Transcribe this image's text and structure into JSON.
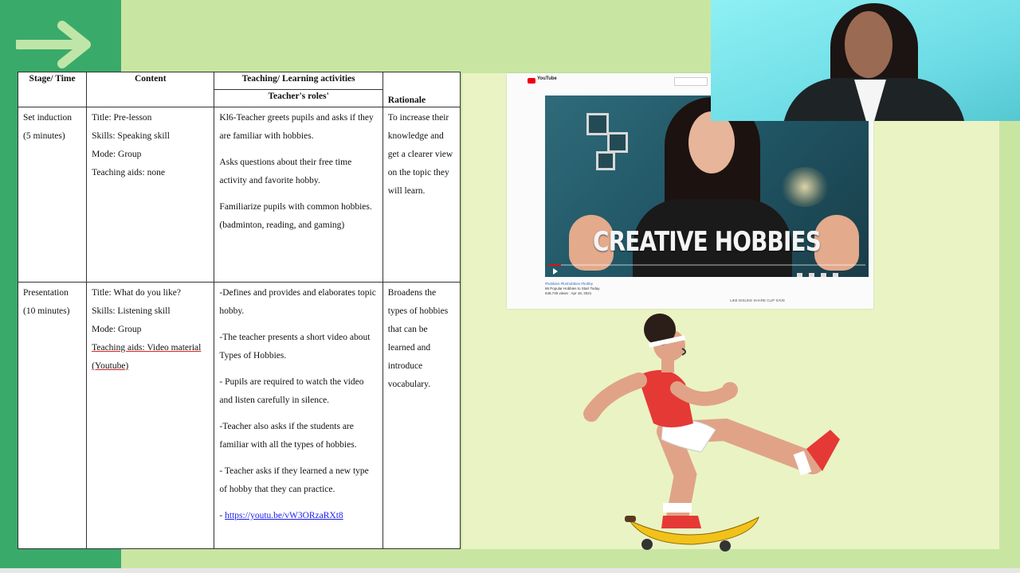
{
  "table": {
    "headers": {
      "stage": "Stage/ Time",
      "content": "Content",
      "activities": "Teaching/ Learning activities",
      "teacher_roles": "Teacher's roles'",
      "rationale": "Rationale"
    },
    "rows": [
      {
        "stage": [
          "Set induction",
          "(5 minutes)"
        ],
        "content": [
          "Title: Pre-lesson",
          "Skills: Speaking skill",
          "Mode: Group",
          "Teaching aids: none"
        ],
        "activities": [
          "Kl6-Teacher greets pupils and asks if they are familiar with hobbies.",
          "Asks questions about their free time activity and favorite hobby.",
          "Familiarize pupils with common hobbies. (badminton, reading, and gaming)"
        ],
        "rationale": "To increase their knowledge and get a clearer view on the topic they will learn."
      },
      {
        "stage": [
          "Presentation",
          "(10 minutes)"
        ],
        "content": [
          "Title: What do you like?",
          "Skills: Listening skill",
          "Mode: Group",
          "Teaching aids: Video material (Youtube)"
        ],
        "activities": [
          "-Defines and provides and elaborates topic hobby.",
          "-The teacher presents a short video about Types of Hobbies.",
          "- Pupils are required to watch the video and listen carefully in silence.",
          "-Teacher also asks if the students are familiar with all the types of hobbies.",
          "- Teacher asks if they learned a new type of hobby that they can practice."
        ],
        "link": "https://youtu.be/vW3ORzaRXt8",
        "rationale": "Broadens the types of hobbies that can be learned and introduce vocabulary."
      }
    ]
  },
  "video": {
    "site": "YouTube",
    "overlay_title": "CREATIVE HOBBIES",
    "tags": "#hobbies #funhobbies #hobby",
    "title": "66 Popular Hobbies to Start Today",
    "meta": "648,745 views · Apr 18, 2021",
    "actions": "LIKE   DISLIKE   SHARE   CLIP   SAVE",
    "progress_fraction": 0.04,
    "accent_color": "#e01010"
  },
  "colors": {
    "background": "#c8e6a2",
    "accent_green": "#3aaa6a",
    "panel": "#eaf3c4"
  }
}
